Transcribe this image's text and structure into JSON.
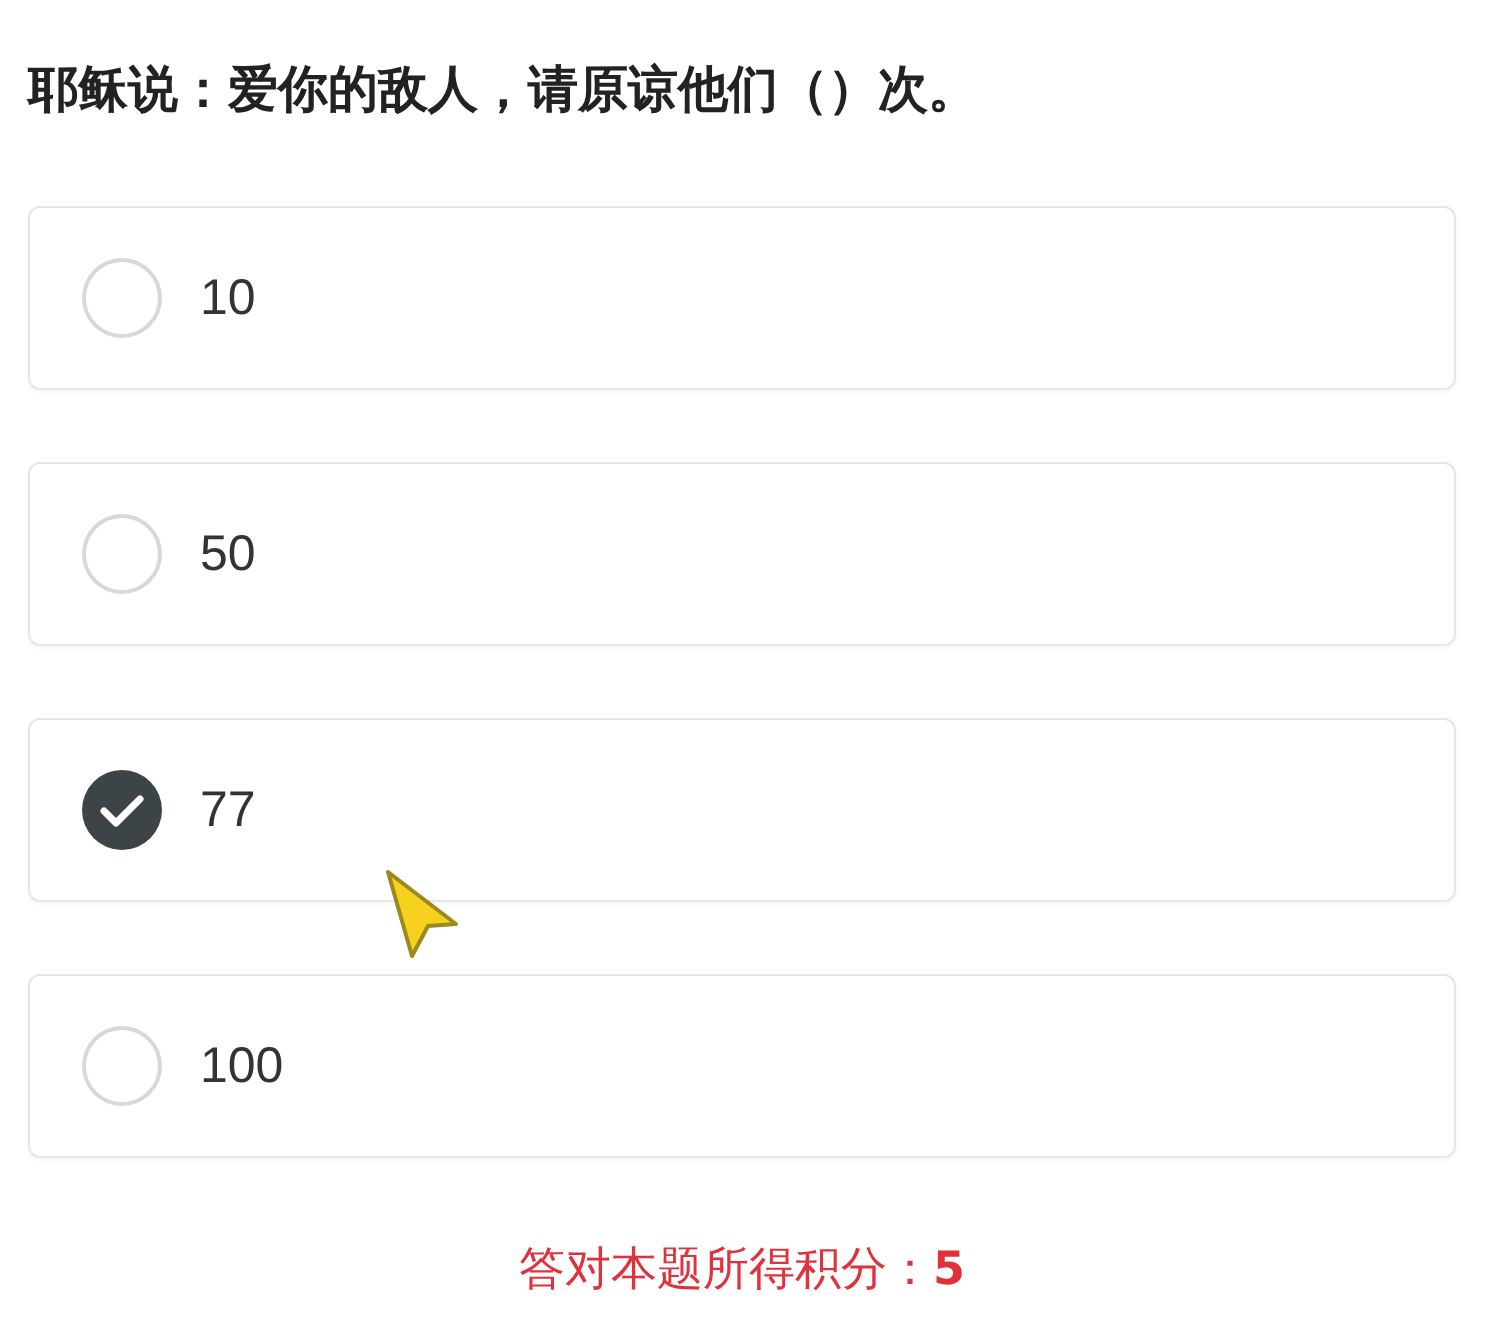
{
  "question": "耶稣说：爱你的敌人，请原谅他们（）次。",
  "options": [
    {
      "label": "10",
      "selected": false
    },
    {
      "label": "50",
      "selected": false
    },
    {
      "label": "77",
      "selected": true
    },
    {
      "label": "100",
      "selected": false
    }
  ],
  "score_note": "答对本题所得积分：**5**"
}
